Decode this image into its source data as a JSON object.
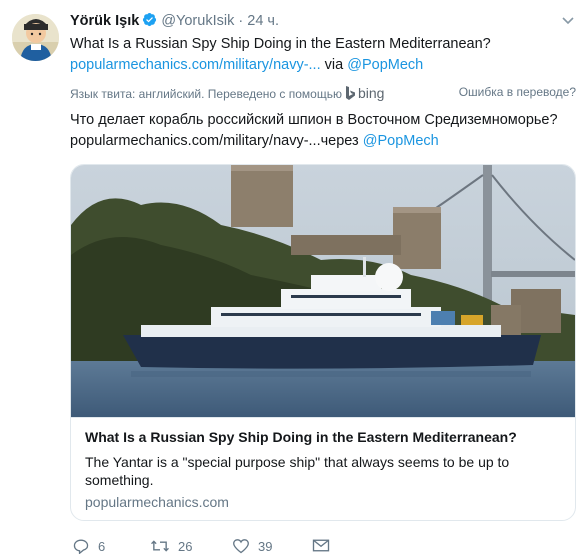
{
  "tweet": {
    "author_name": "Yörük Işık",
    "author_handle": "@YorukIsik",
    "separator": "·",
    "time": "24 ч.",
    "text": "What Is a Russian Spy Ship Doing in the Eastern Mediterranean?",
    "link_text": "popularmechanics.com/military/navy-...",
    "via_label": "via",
    "via_mention": "@PopMech"
  },
  "translation_bar": {
    "language_note": "Язык твита: английский. Переведено с помощью",
    "provider": "bing",
    "wrong_translation": "Ошибка в переводе?"
  },
  "translation": {
    "text": "Что делает корабль российский шпион в Восточном Средиземноморье?",
    "link_text": "popularmechanics.com/military/navy-...",
    "via_label": "через",
    "via_mention": "@PopMech"
  },
  "card": {
    "title": "What Is a Russian Spy Ship Doing in the Eastern Mediterranean?",
    "description": "The Yantar is a \"special purpose ship\" that always seems to be up to something.",
    "domain": "popularmechanics.com"
  },
  "actions": {
    "replies": "6",
    "retweets": "26",
    "likes": "39"
  },
  "colors": {
    "link": "#1b95e0",
    "muted": "#657786",
    "verified": "#1da1f2"
  },
  "icons": [
    "verified-badge-icon",
    "chevron-down-icon",
    "bing-logo-icon",
    "reply-icon",
    "retweet-icon",
    "like-icon",
    "message-icon"
  ]
}
